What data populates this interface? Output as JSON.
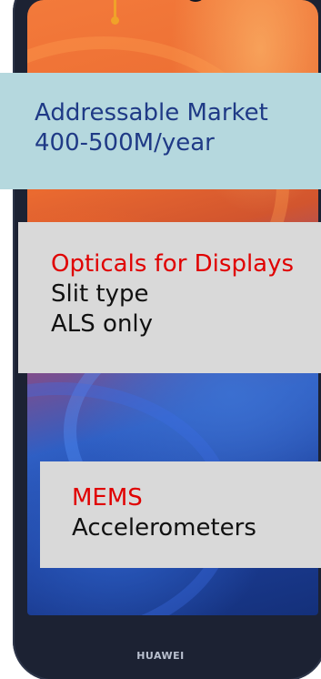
{
  "device": {
    "brand": "HUAWEI"
  },
  "market": {
    "line1": "Addressable Market",
    "line2": "400-500M/year"
  },
  "optical": {
    "title": "Opticals for Displays",
    "line1": "Slit type",
    "line2": "ALS only"
  },
  "mems": {
    "title": "MEMS",
    "line1": "Accelerometers"
  },
  "colors": {
    "market_bg": "#b5d8de",
    "market_text": "#1f3a86",
    "panel_bg": "#d9d9d9",
    "accent_red": "#e00000",
    "pointer": "#f0a229"
  }
}
